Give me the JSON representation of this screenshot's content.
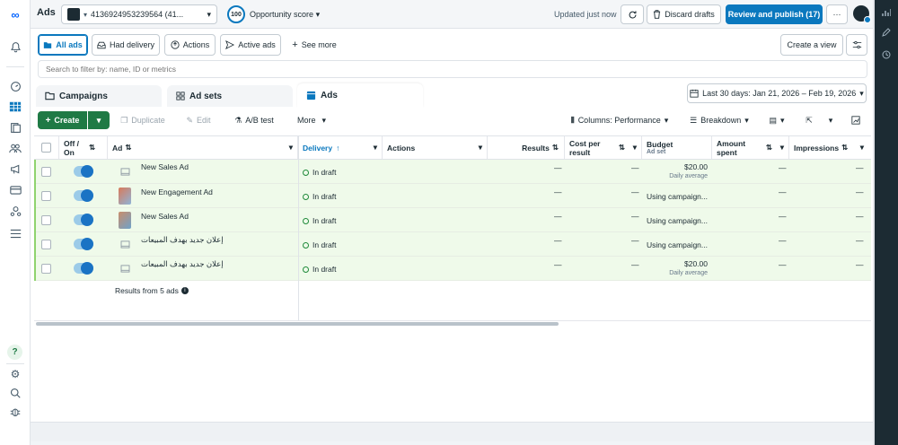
{
  "app": {
    "title": "Ads"
  },
  "account": {
    "id": "4136924953239564 (41..."
  },
  "opportunity": {
    "score": "100",
    "label": "Opportunity score"
  },
  "status": {
    "updated": "Updated just now"
  },
  "actions": {
    "discard": "Discard drafts",
    "publish": "Review and publish (17)",
    "more": "···"
  },
  "filters": {
    "items": [
      "All ads",
      "Had delivery",
      "Actions",
      "Active ads"
    ],
    "see_more": "See more",
    "create_view": "Create a view",
    "search_placeholder": "Search to filter by: name, ID or metrics"
  },
  "tabs": {
    "campaigns": "Campaigns",
    "adsets": "Ad sets",
    "ads": "Ads"
  },
  "date_range": "Last 30 days: Jan 21, 2026 – Feb 19, 2026",
  "toolbar": {
    "create": "Create",
    "duplicate": "Duplicate",
    "edit": "Edit",
    "ab_test": "A/B test",
    "more": "More",
    "columns": "Columns: Performance",
    "breakdown": "Breakdown"
  },
  "table": {
    "headers": {
      "offon": "Off / On",
      "ad": "Ad",
      "delivery": "Delivery",
      "actions": "Actions",
      "results": "Results",
      "cost_per_result": "Cost per result",
      "budget": "Budget",
      "budget_sub": "Ad set",
      "amount_spent": "Amount spent",
      "impressions": "Impressions"
    },
    "rows": [
      {
        "name": "New Sales Ad",
        "delivery": "In draft",
        "results": "—",
        "cost": "—",
        "budget": "$20.00",
        "budget_sub": "Daily average",
        "spent": "—",
        "impressions": "—"
      },
      {
        "name": "New Engagement Ad",
        "delivery": "In draft",
        "results": "—",
        "cost": "—",
        "budget": "Using campaign...",
        "budget_sub": "",
        "spent": "—",
        "impressions": "—"
      },
      {
        "name": "New Sales Ad",
        "delivery": "In draft",
        "results": "—",
        "cost": "—",
        "budget": "Using campaign...",
        "budget_sub": "",
        "spent": "—",
        "impressions": "—"
      },
      {
        "name": "إعلان جديد بهدف المبيعات",
        "delivery": "In draft",
        "results": "—",
        "cost": "—",
        "budget": "Using campaign...",
        "budget_sub": "",
        "spent": "—",
        "impressions": "—"
      },
      {
        "name": "إعلان جديد بهدف المبيعات",
        "delivery": "In draft",
        "results": "—",
        "cost": "—",
        "budget": "$20.00",
        "budget_sub": "Daily average",
        "spent": "—",
        "impressions": "—"
      }
    ],
    "footer": "Results from 5 ads"
  },
  "colors": {
    "accent": "#0a78be",
    "create": "#1f7a45",
    "draft_row": "#effaea"
  }
}
